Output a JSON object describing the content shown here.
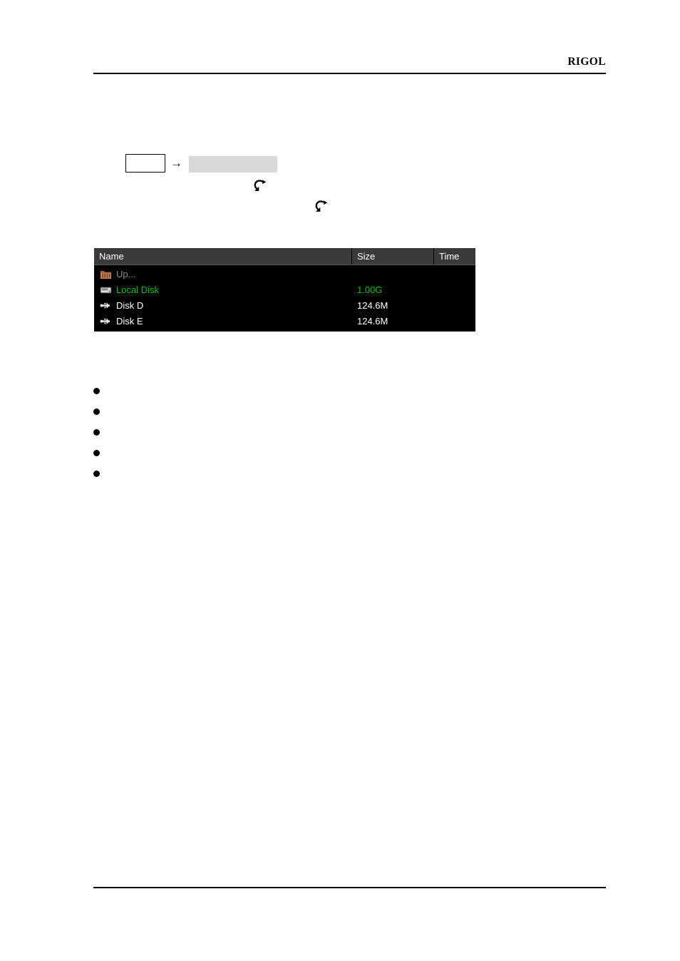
{
  "header": {
    "brand": "RIGOL"
  },
  "menu_path": {
    "key_label": "",
    "arrow": "→",
    "softkey_label": ""
  },
  "icons": {
    "refresh_1": "refresh-icon",
    "refresh_2": "refresh-icon"
  },
  "file_browser": {
    "columns": [
      "Name",
      "Size",
      "Time"
    ],
    "rows": [
      {
        "icon": "folder-up-icon",
        "name": "Up...",
        "size": "",
        "time": "",
        "style": "row-grey"
      },
      {
        "icon": "local-disk-icon",
        "name": "Local Disk",
        "size": "1.00G",
        "time": "",
        "style": "row-green"
      },
      {
        "icon": "usb-disk-icon",
        "name": "Disk D",
        "size": "124.6M",
        "time": "",
        "style": "row-white"
      },
      {
        "icon": "usb-disk-icon",
        "name": "Disk E",
        "size": "124.6M",
        "time": "",
        "style": "row-white"
      }
    ]
  },
  "bullets": [
    {
      "text": ""
    },
    {
      "text": ""
    },
    {
      "text": ""
    },
    {
      "text": ""
    },
    {
      "text": ""
    }
  ]
}
